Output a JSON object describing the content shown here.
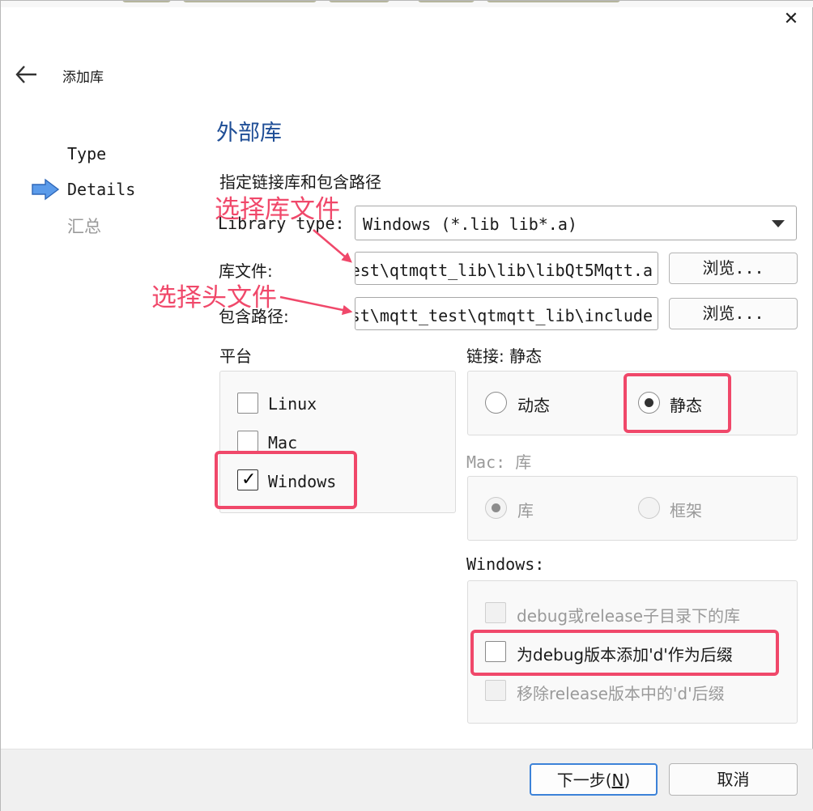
{
  "window": {
    "title": "添加库"
  },
  "steps": [
    {
      "label": "Type"
    },
    {
      "label": "Details"
    },
    {
      "label": "汇总"
    }
  ],
  "page": {
    "heading": "外部库",
    "subtitle": "指定链接库和包含路径"
  },
  "form": {
    "library_type": {
      "label": "Library type:",
      "value": "Windows (*.lib lib*.a)"
    },
    "library_file": {
      "label": "库文件:",
      "value": "est\\qtmqtt_lib\\lib\\libQt5Mqtt.a",
      "browse": "浏览..."
    },
    "include_path": {
      "label": "包含路径:",
      "value": "st\\mqtt_test\\qtmqtt_lib\\include",
      "browse": "浏览..."
    }
  },
  "platform": {
    "title": "平台",
    "options": [
      {
        "label": "Linux",
        "checked": false
      },
      {
        "label": "Mac",
        "checked": false
      },
      {
        "label": "Windows",
        "checked": true
      }
    ]
  },
  "linkage": {
    "title": "链接: 静态",
    "options": [
      {
        "label": "动态",
        "selected": false
      },
      {
        "label": "静态",
        "selected": true
      }
    ]
  },
  "mac": {
    "title": "Mac: 库",
    "options": [
      {
        "label": "库",
        "selected": true,
        "enabled": false
      },
      {
        "label": "框架",
        "selected": false,
        "enabled": false
      }
    ]
  },
  "windows": {
    "title": "Windows:",
    "options": [
      {
        "label": "debug或release子目录下的库",
        "checked": false,
        "enabled": false
      },
      {
        "label": "为debug版本添加'd'作为后缀",
        "checked": false,
        "enabled": true
      },
      {
        "label": "移除release版本中的'd'后缀",
        "checked": false,
        "enabled": false
      }
    ]
  },
  "annotations": {
    "select_lib": "选择库文件",
    "select_header": "选择头文件",
    "color": "#f0486a"
  },
  "footer": {
    "next": "下一步(",
    "next_mnemonic": "N",
    "next_tail": ")",
    "cancel": "取消"
  },
  "icons": {
    "back": "arrow-left-icon",
    "close": "close-icon",
    "current_step": "arrow-right-icon"
  }
}
